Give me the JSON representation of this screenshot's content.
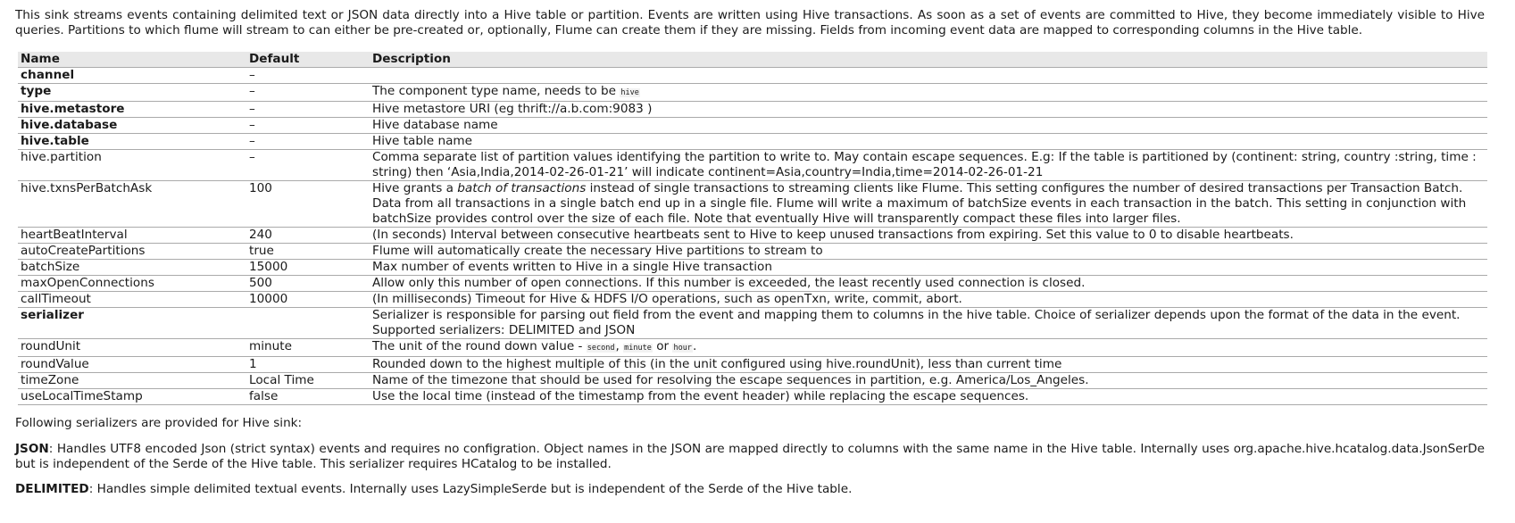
{
  "intro": "This sink streams events containing delimited text or JSON data directly into a Hive table or partition. Events are written using Hive transactions. As soon as a set of events are committed to Hive, they become immediately visible to Hive queries. Partitions to which flume will stream to can either be pre-created or, optionally, Flume can create them if they are missing. Fields from incoming event data are mapped to corresponding columns in the Hive table.",
  "table": {
    "headers": {
      "name": "Name",
      "default": "Default",
      "description": "Description"
    },
    "rows": [
      {
        "name": "channel",
        "default": "–",
        "description": ""
      },
      {
        "name": "type",
        "default": "–",
        "description": "The component type name, needs to be ",
        "code": "hive"
      },
      {
        "name": "hive.metastore",
        "default": "–",
        "description": "Hive metastore URI (eg thrift://a.b.com:9083 )"
      },
      {
        "name": "hive.database",
        "default": "–",
        "description": "Hive database name"
      },
      {
        "name": "hive.table",
        "default": "–",
        "description": "Hive table name"
      },
      {
        "name": "hive.partition",
        "default": "–",
        "description": "Comma separate list of partition values identifying the partition to write to. May contain escape sequences. E.g: If the table is partitioned by (continent: string, country :string, time : string) then ‘Asia,India,2014-02-26-01-21’ will indicate continent=Asia,country=India,time=2014-02-26-01-21"
      },
      {
        "name": "hive.txnsPerBatchAsk",
        "default": "100",
        "description_pre": "Hive grants a ",
        "description_em": "batch of transactions",
        "description_post": " instead of single transactions to streaming clients like Flume. This setting configures the number of desired transactions per Transaction Batch. Data from all transactions in a single batch end up in a single file. Flume will write a maximum of batchSize events in each transaction in the batch. This setting in conjunction with batchSize provides control over the size of each file. Note that eventually Hive will transparently compact these files into larger files."
      },
      {
        "name": "heartBeatInterval",
        "default": "240",
        "description": "(In seconds) Interval between consecutive heartbeats sent to Hive to keep unused transactions from expiring. Set this value to 0 to disable heartbeats."
      },
      {
        "name": "autoCreatePartitions",
        "default": "true",
        "description": "Flume will automatically create the necessary Hive partitions to stream to"
      },
      {
        "name": "batchSize",
        "default": "15000",
        "description": "Max number of events written to Hive in a single Hive transaction"
      },
      {
        "name": "maxOpenConnections",
        "default": "500",
        "description": "Allow only this number of open connections. If this number is exceeded, the least recently used connection is closed."
      },
      {
        "name": "callTimeout",
        "default": "10000",
        "description": "(In milliseconds) Timeout for Hive & HDFS I/O operations, such as openTxn, write, commit, abort."
      },
      {
        "name": "serializer",
        "default": "",
        "description": "Serializer is responsible for parsing out field from the event and mapping them to columns in the hive table. Choice of serializer depends upon the format of the data in the event. Supported serializers: DELIMITED and JSON"
      },
      {
        "name": "roundUnit",
        "default": "minute",
        "description_pre": "The unit of the round down value - ",
        "code1": "second",
        "sep1": ", ",
        "code2": "minute",
        "sep2": " or ",
        "code3": "hour",
        "description_post": "."
      },
      {
        "name": "roundValue",
        "default": "1",
        "description": "Rounded down to the highest multiple of this (in the unit configured using hive.roundUnit), less than current time"
      },
      {
        "name": "timeZone",
        "default": "Local Time",
        "description": "Name of the timezone that should be used for resolving the escape sequences in partition, e.g. America/Los_Angeles."
      },
      {
        "name": "useLocalTimeStamp",
        "default": "false",
        "description": "Use the local time (instead of the timestamp from the event header) while replacing the escape sequences."
      }
    ]
  },
  "serializers_intro": "Following serializers are provided for Hive sink:",
  "json_serializer": {
    "label": "JSON",
    "text": ": Handles UTF8 encoded Json (strict syntax) events and requires no configration. Object names in the JSON are mapped directly to columns with the same name in the Hive table. Internally uses org.apache.hive.hcatalog.data.JsonSerDe but is independent of the Serde of the Hive table. This serializer requires HCatalog to be installed."
  },
  "delimited_serializer": {
    "label": "DELIMITED",
    "text": ": Handles simple delimited textual events. Internally uses LazySimpleSerde but is independent of the Serde of the Hive table."
  }
}
